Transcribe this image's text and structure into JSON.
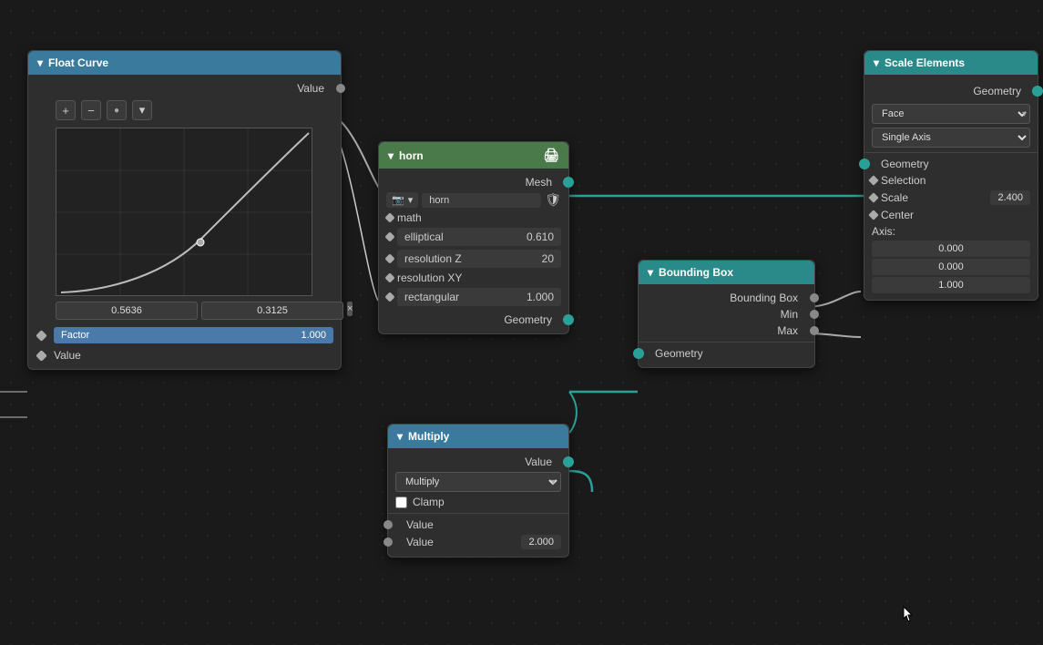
{
  "floatCurve": {
    "title": "Float Curve",
    "value_label": "Value",
    "x_value": "0.5636",
    "y_value": "0.3125",
    "factor_label": "Factor",
    "factor_value": "1.000",
    "value_output": "Value"
  },
  "horn": {
    "title": "horn",
    "mesh_label": "Mesh",
    "name_value": "horn",
    "math_label": "math",
    "elliptical_label": "elliptical",
    "elliptical_value": "0.610",
    "resolution_z_label": "resolution Z",
    "resolution_z_value": "20",
    "resolution_xy_label": "resolution XY",
    "rectangular_label": "rectangular",
    "rectangular_value": "1.000",
    "geometry_label": "Geometry"
  },
  "boundingBox": {
    "title": "Bounding Box",
    "bounding_box_label": "Bounding Box",
    "min_label": "Min",
    "max_label": "Max",
    "geometry_label": "Geometry"
  },
  "scaleElements": {
    "title": "Scale Elements",
    "geometry_label": "Geometry",
    "face_option": "Face",
    "single_axis_option": "Single Axis",
    "geometry_input": "Geometry",
    "selection_label": "Selection",
    "scale_label": "Scale",
    "scale_value": "2.400",
    "center_label": "Center",
    "axis_label": "Axis:",
    "axis_x": "0.000",
    "axis_y": "0.000",
    "axis_z": "1.000"
  },
  "multiply": {
    "title": "Multiply",
    "value_label": "Value",
    "operation_label": "Multiply",
    "clamp_label": "Clamp",
    "value1_label": "Value",
    "value1_value": "",
    "value2_label": "Value",
    "value2_value": "2.000"
  },
  "icons": {
    "chevron_down": "▾",
    "plus": "+",
    "minus": "−",
    "circle": "●",
    "close": "×",
    "printer": "🖨",
    "shield": "🛡",
    "camera": "📷"
  }
}
